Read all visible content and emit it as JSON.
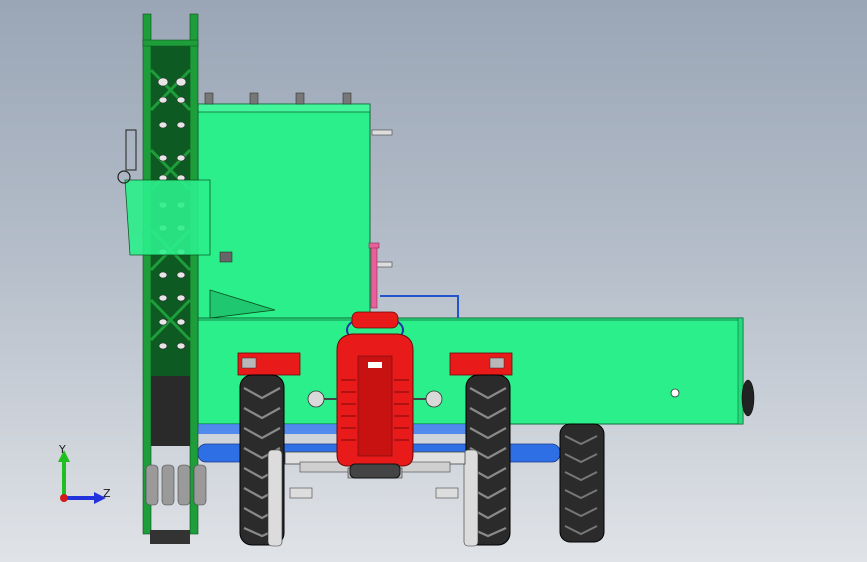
{
  "scene": {
    "colors": {
      "background_top": "#9aa6b6",
      "background_bottom": "#e0e3e7",
      "hopper": "#2bef8a",
      "frame": "#1e9e3a",
      "tractor_red": "#e81a1a",
      "tire": "#2b2b2b",
      "axle_blue": "#2f6fe6",
      "pipe_pink": "#e8609a"
    },
    "triad": {
      "y_label": "Y",
      "z_label": "Z",
      "y_color": "#1fbf1f",
      "z_color": "#2233dd",
      "x_color": "#d11a1a"
    }
  }
}
